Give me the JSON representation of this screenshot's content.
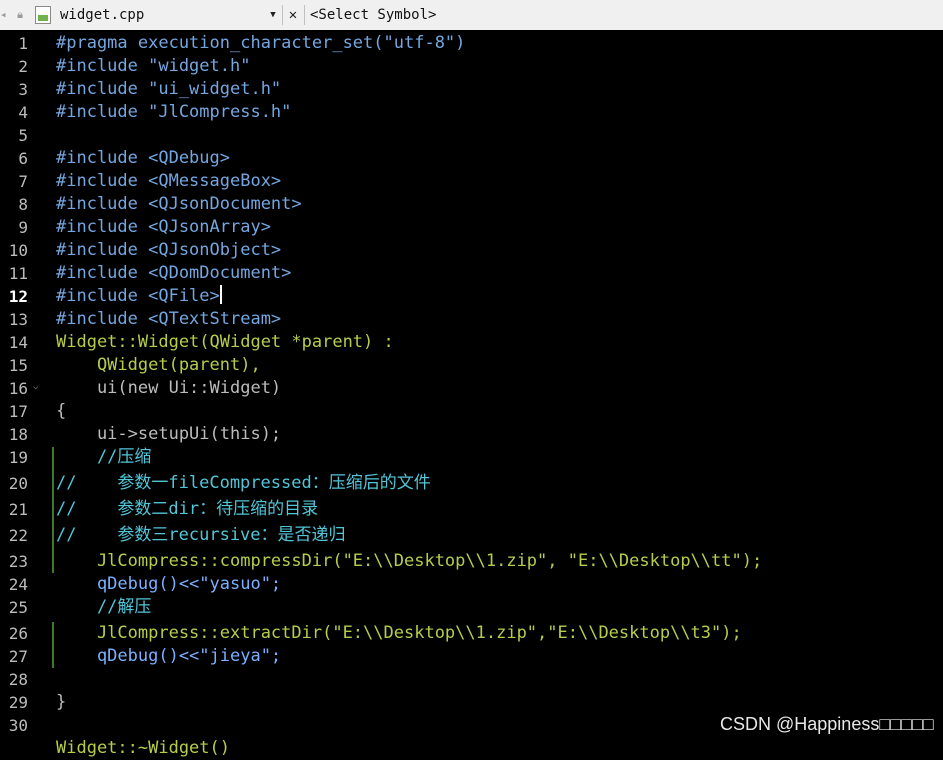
{
  "toolbar": {
    "filename": "widget.cpp",
    "symbol": "<Select Symbol>",
    "icons": [
      "nav-arrow-icon",
      "lock-icon",
      "cpp-file-icon",
      "dropdown-icon",
      "close-icon"
    ]
  },
  "editor": {
    "current_line": 12,
    "line_numbers": [
      "1",
      "2",
      "3",
      "4",
      "5",
      "6",
      "7",
      "8",
      "9",
      "10",
      "11",
      "12",
      "13",
      "14",
      "15",
      "16",
      "17",
      "18",
      "19",
      "20",
      "21",
      "22",
      "23",
      "24",
      "25",
      "26",
      "27",
      "28",
      "29",
      "30"
    ],
    "lines": [
      "#pragma execution_character_set(\"utf-8\")",
      "#include \"widget.h\"",
      "#include \"ui_widget.h\"",
      "#include \"JlCompress.h\"",
      "",
      "#include <QDebug>",
      "#include <QMessageBox>",
      "#include <QJsonDocument>",
      "#include <QJsonArray>",
      "#include <QJsonObject>",
      "#include <QDomDocument>",
      "#include <QFile>",
      "#include <QTextStream>",
      "Widget::Widget(QWidget *parent) :",
      "    QWidget(parent),",
      "    ui(new Ui::Widget)",
      "{",
      "    ui->setupUi(this);",
      "    //压缩",
      "//    参数一fileCompressed：压缩后的文件",
      "//    参数二dir：待压缩的目录",
      "//    参数三recursive：是否递归",
      "    JlCompress::compressDir(\"E:\\\\Desktop\\\\1.zip\", \"E:\\\\Desktop\\\\tt\");",
      "    qDebug()<<\"yasuo\";",
      "    //解压",
      "    JlCompress::extractDir(\"E:\\\\Desktop\\\\1.zip\",\"E:\\\\Desktop\\\\t3\");",
      "    qDebug()<<\"jieya\";",
      "",
      "}",
      "",
      "Widget::~Widget()"
    ]
  },
  "watermark": "CSDN @Happiness□□□□□",
  "colors": {
    "background": "#000000",
    "preprocessor": "#74a6e0",
    "string": "#d39cd6",
    "keyword": "#e6e04a",
    "class": "#b5ce4a",
    "comment": "#52c6d8",
    "highlight": "#5a5a16"
  }
}
